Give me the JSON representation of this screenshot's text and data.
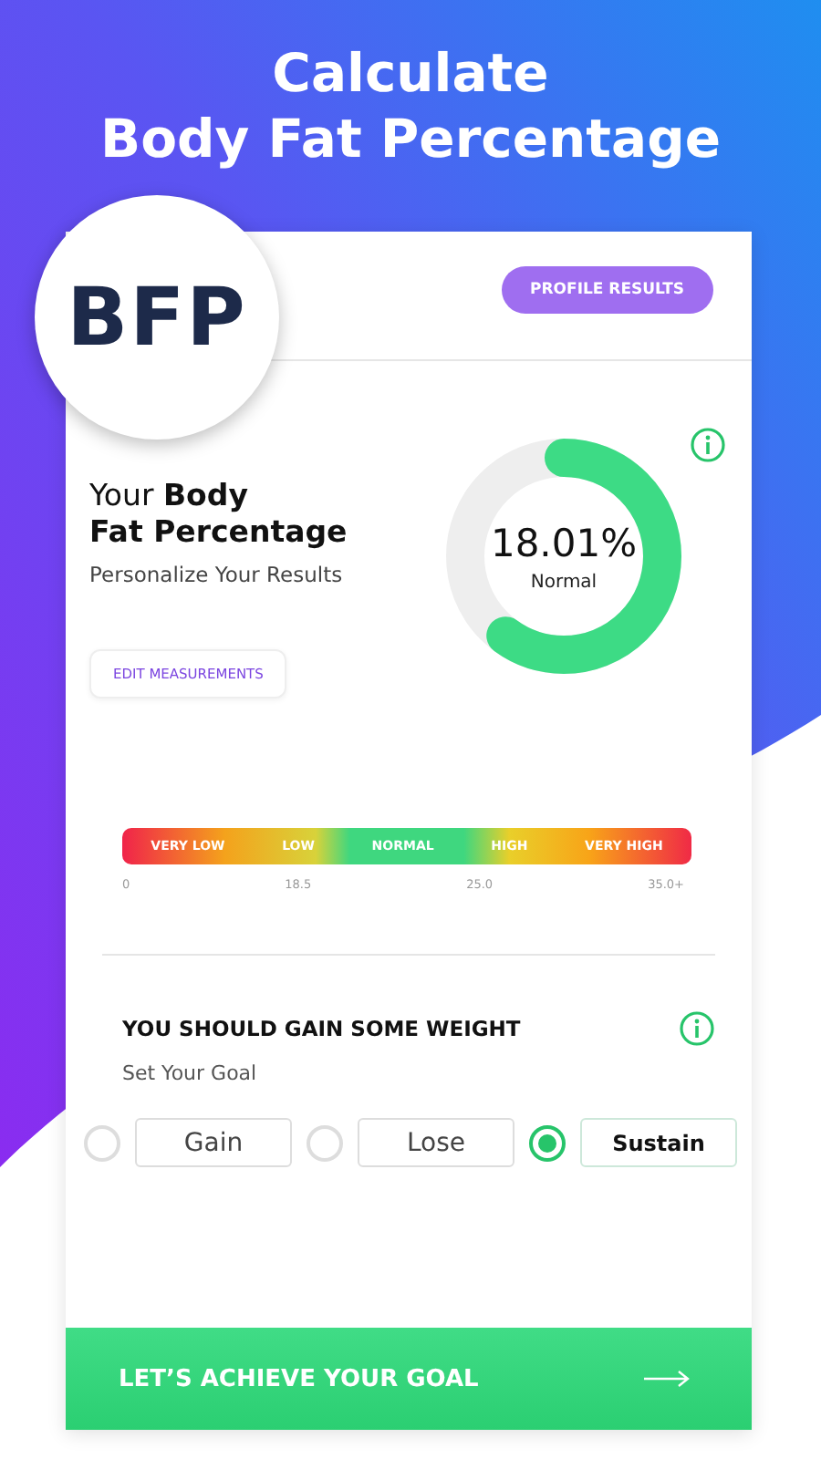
{
  "headline": [
    "Calculate",
    "Body Fat Percentage"
  ],
  "badge": "BFP",
  "header": {
    "button": "PROFILE RESULTS"
  },
  "result": {
    "title_plain": "Your ",
    "title_bold": "Body",
    "title_line2": "Fat Percentage",
    "subtitle": "Personalize Your Results",
    "edit_button": "EDIT MEASUREMENTS",
    "value": "18.01%",
    "category": "Normal",
    "level": 0.6
  },
  "scale": {
    "bands": [
      "VERY LOW",
      "LOW",
      "NORMAL",
      "HIGH",
      "VERY HIGH"
    ],
    "ticks": [
      "0",
      "18.5",
      "25.0",
      "35.0+"
    ]
  },
  "advice": {
    "title": "YOU SHOULD GAIN SOME WEIGHT",
    "subtitle": "Set Your Goal"
  },
  "goals": [
    {
      "label": "Gain",
      "selected": false
    },
    {
      "label": "Lose",
      "selected": false
    },
    {
      "label": "Sustain",
      "selected": true
    }
  ],
  "cta": {
    "label": "LET’S ACHIEVE YOUR GOAL"
  }
}
